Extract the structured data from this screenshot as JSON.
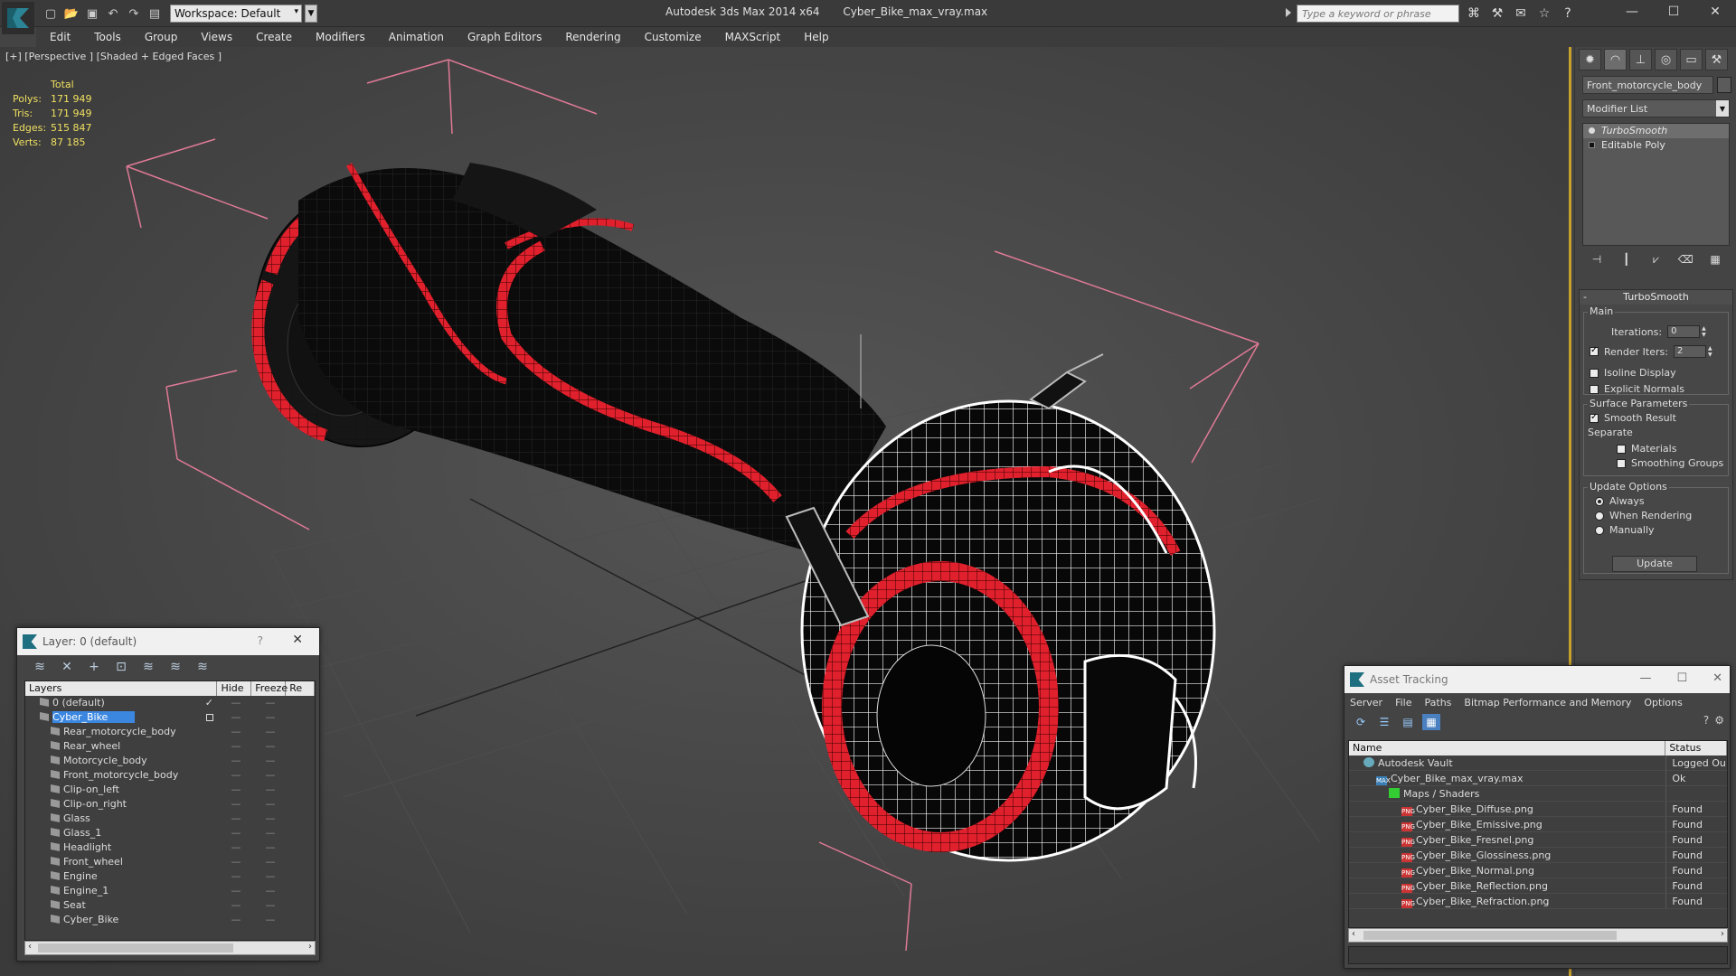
{
  "titlebar": {
    "workspace": "Workspace: Default",
    "app_name": "Autodesk 3ds Max 2014 x64",
    "file_name": "Cyber_Bike_max_vray.max",
    "search_placeholder": "Type a keyword or phrase"
  },
  "menu": [
    "Edit",
    "Tools",
    "Group",
    "Views",
    "Create",
    "Modifiers",
    "Animation",
    "Graph Editors",
    "Rendering",
    "Customize",
    "MAXScript",
    "Help"
  ],
  "viewport": {
    "label": "[+] [Perspective ] [Shaded + Edged Faces ]",
    "stats": {
      "total_label": "Total",
      "rows": [
        {
          "label": "Polys:",
          "value": "171 949"
        },
        {
          "label": "Tris:",
          "value": "171 949"
        },
        {
          "label": "Edges:",
          "value": "515 847"
        },
        {
          "label": "Verts:",
          "value": "87 185"
        }
      ]
    }
  },
  "command_panel": {
    "object_name": "Front_motorcycle_body",
    "modifier_list": "Modifier List",
    "stack": [
      "TurboSmooth",
      "Editable Poly"
    ],
    "turbosmooth": {
      "title": "TurboSmooth",
      "main_group": "Main",
      "iterations_label": "Iterations:",
      "iterations_value": "0",
      "render_iters_label": "Render Iters:",
      "render_iters_value": "2",
      "isoline_label": "Isoline Display",
      "explicit_label": "Explicit Normals",
      "surface_group": "Surface Parameters",
      "smooth_result_label": "Smooth Result",
      "separate_label": "Separate",
      "materials_label": "Materials",
      "smoothing_groups_label": "Smoothing Groups",
      "update_group": "Update Options",
      "always_label": "Always",
      "when_rendering_label": "When Rendering",
      "manually_label": "Manually",
      "update_button": "Update"
    }
  },
  "layer_window": {
    "title": "Layer: 0 (default)",
    "help": "?",
    "columns": [
      "Layers",
      "Hide",
      "Freeze",
      "Re"
    ],
    "rows": [
      {
        "name": "0 (default)",
        "indent": 1,
        "check": "✓"
      },
      {
        "name": "Cyber_Bike",
        "indent": 1,
        "selected": true
      },
      {
        "name": "Rear_motorcycle_body",
        "indent": 2
      },
      {
        "name": "Rear_wheel",
        "indent": 2
      },
      {
        "name": "Motorcycle_body",
        "indent": 2
      },
      {
        "name": "Front_motorcycle_body",
        "indent": 2
      },
      {
        "name": "Clip-on_left",
        "indent": 2
      },
      {
        "name": "Clip-on_right",
        "indent": 2
      },
      {
        "name": "Glass",
        "indent": 2
      },
      {
        "name": "Glass_1",
        "indent": 2
      },
      {
        "name": "Headlight",
        "indent": 2
      },
      {
        "name": "Front_wheel",
        "indent": 2
      },
      {
        "name": "Engine",
        "indent": 2
      },
      {
        "name": "Engine_1",
        "indent": 2
      },
      {
        "name": "Seat",
        "indent": 2
      },
      {
        "name": "Cyber_Bike",
        "indent": 2
      }
    ]
  },
  "asset_window": {
    "title": "Asset Tracking",
    "menu": [
      "Server",
      "File",
      "Paths",
      "Bitmap Performance and Memory",
      "Options"
    ],
    "columns": [
      "Name",
      "Status"
    ],
    "rows": [
      {
        "name": "Autodesk Vault",
        "status": "Logged Ou",
        "icon": "vault",
        "indent": 0
      },
      {
        "name": "Cyber_Bike_max_vray.max",
        "status": "Ok",
        "icon": "max",
        "indent": 1
      },
      {
        "name": "Maps / Shaders",
        "status": "",
        "icon": "folder",
        "indent": 2
      },
      {
        "name": "Cyber_Bike_Diffuse.png",
        "status": "Found",
        "icon": "png",
        "indent": 3
      },
      {
        "name": "Cyber_Bike_Emissive.png",
        "status": "Found",
        "icon": "png",
        "indent": 3
      },
      {
        "name": "Cyber_Bike_Fresnel.png",
        "status": "Found",
        "icon": "png",
        "indent": 3
      },
      {
        "name": "Cyber_Bike_Glossiness.png",
        "status": "Found",
        "icon": "png",
        "indent": 3
      },
      {
        "name": "Cyber_Bike_Normal.png",
        "status": "Found",
        "icon": "png",
        "indent": 3
      },
      {
        "name": "Cyber_Bike_Reflection.png",
        "status": "Found",
        "icon": "png",
        "indent": 3
      },
      {
        "name": "Cyber_Bike_Refraction.png",
        "status": "Found",
        "icon": "png",
        "indent": 3
      }
    ]
  },
  "colors": {
    "stats_text": "#f0e060",
    "selection": "#3b87e0",
    "bike_accent": "#e0202c",
    "bbox_lines": "#e07a96",
    "viewport_bg": "#444444"
  }
}
